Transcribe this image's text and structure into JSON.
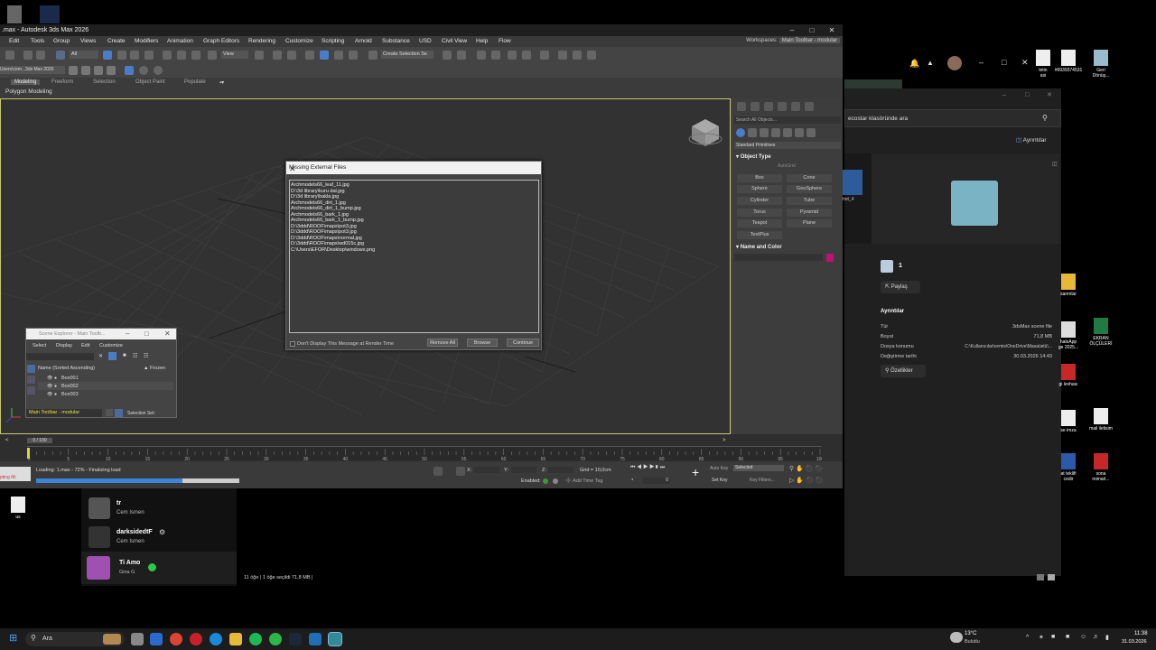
{
  "max": {
    "title": ".max - Autodesk 3ds Max 2026",
    "menu": [
      "Edit",
      "Tools",
      "Group",
      "Views",
      "Create",
      "Modifiers",
      "Animation",
      "Graph Editors",
      "Rendering",
      "Customize",
      "Scripting",
      "Arnold",
      "Substance",
      "USD",
      "Civil View",
      "Help",
      "Flow"
    ],
    "workspaces_label": "Workspaces:",
    "workspace_value": "Main Toolbar - modular",
    "toolbar_filter": "All",
    "toolbar_view": "View",
    "create_selection_set": "Create Selection Se",
    "toolbar2_label": "Users\\cem...3ds Max 2026",
    "ribbon_tabs": [
      "Modeling",
      "Freeform",
      "Selection",
      "Object Paint",
      "Populate"
    ],
    "ribbon_sub": "Polygon Modeling",
    "command_panel": {
      "search_placeholder": "Search All Objects...",
      "category": "Standard Primitives",
      "object_type_header": "Object Type",
      "autogrid": "AutoGrid",
      "buttons": [
        "Box",
        "Cone",
        "Sphere",
        "GeoSphere",
        "Cylinder",
        "Tube",
        "Torus",
        "Pyramid",
        "Teapot",
        "Plane",
        "TextPlus"
      ],
      "name_color_header": "Name and Color",
      "swatch_color": "#c0107a"
    },
    "timeline": {
      "frame_counter": "0 / 100",
      "ticks": [
        "0",
        "5",
        "10",
        "15",
        "20",
        "25",
        "30",
        "35",
        "40",
        "45",
        "50",
        "55",
        "60",
        "65",
        "70",
        "75",
        "80",
        "85",
        "90",
        "95",
        "100"
      ]
    },
    "status": {
      "loading_text": "Loading: 1.max - 72% - Finalizing load",
      "progress": 0.72,
      "x_label": "X:",
      "y_label": "Y:",
      "z_label": "Z:",
      "grid": "Grid = 10,0cm",
      "enabled_label": "Enabled:",
      "add_time_tag": "Add Time Tag",
      "auto_key": "Auto Key",
      "selected": "Selected",
      "set_key": "Set Key",
      "key_filters": "Key Filters...",
      "frame_value": "0",
      "script_label": "pting Mi"
    }
  },
  "dialog": {
    "title": "Missing External Files",
    "files": [
      "Archmodels66_leaf_11.jpg",
      "D:\\3d library\\kuru dal.jpg",
      "D:\\3d library\\bakla.jpg",
      "Archmodels66_dirt_1.jpg",
      "Archmodels66_dirt_1_bump.jpg",
      "Archmodels66_bark_1.jpg",
      "Archmodels66_bark_1_bump.jpg",
      "D:\\3ddd\\ROOF\\maps\\pot3.jpg",
      "D:\\3ddd\\ROOF\\maps\\pot3.jpg",
      "D:\\3ddd\\ROOF\\maps\\normal.jpg",
      "D:\\3ddd\\ROOF\\maps\\wd015c.jpg",
      "C:\\Users\\EFOR\\Desktop\\windows.png"
    ],
    "checkbox_label": "Don't Display This Message at Render Time",
    "remove_all": "Remove All",
    "browse": "Browse",
    "continue": "Continue"
  },
  "scene_explorer": {
    "title": "Scene Explorer - Main Toolb...",
    "menu": [
      "Select",
      "Display",
      "Edit",
      "Customize"
    ],
    "col_name": "Name (Sorted Ascending)",
    "col_frozen": "▲ Frozen",
    "rows": [
      "Box001",
      "Box002",
      "Box003"
    ],
    "footer_left": "Main Toolbar - modular",
    "footer_right": "Selection Set:"
  },
  "explorer": {
    "search_text": "ecostar klasöründe ara",
    "details_btn": "Ayrıntılar",
    "thumb_caption": "hot_4",
    "file_name": "1",
    "share": "Paylaş",
    "details_header": "Ayrıntılar",
    "rows": [
      {
        "k": "Tür",
        "v": "3dsMax scene file"
      },
      {
        "k": "Boyut",
        "v": "71,8 MB"
      },
      {
        "k": "Dosya konumu",
        "v": "C:\\Kullanıcılar\\cemis\\OneDrive\\Masaüstü\\..."
      },
      {
        "k": "Değiştirme tarihi",
        "v": "30.03.2026 14:43"
      }
    ],
    "properties": "Özellikler",
    "status_bar": "11 öğe   |   1 öğe seçildi  71,8 MB   |"
  },
  "chats": [
    {
      "name": "tr",
      "sub": "Cem Ismen"
    },
    {
      "name": "darksidedtF",
      "sub": "Cem Ismen"
    },
    {
      "name": "Ti Amo",
      "sub": "Gina G"
    }
  ],
  "desktop_icons": [
    {
      "label": "letin\nasi"
    },
    {
      "label": "#6939374531"
    },
    {
      "label": "Geri\nDönüş..."
    },
    {
      "label": "sanmlar"
    },
    {
      "label": "hatsApp\nge 2025..."
    },
    {
      "label": "EKRAN\nÖLÇÜLERİ"
    },
    {
      "label": "gi levhası"
    },
    {
      "label": "se imza"
    },
    {
      "label": "mail iletisim"
    },
    {
      "label": "at teklifi\ncedir"
    },
    {
      "label": "sona\nmimarl..."
    },
    {
      "label": "us"
    }
  ],
  "taskbar": {
    "search": "Ara",
    "weather_temp": "13°C",
    "weather_desc": "Bulutlu",
    "time": "11:38",
    "date": "31.03.2026"
  }
}
